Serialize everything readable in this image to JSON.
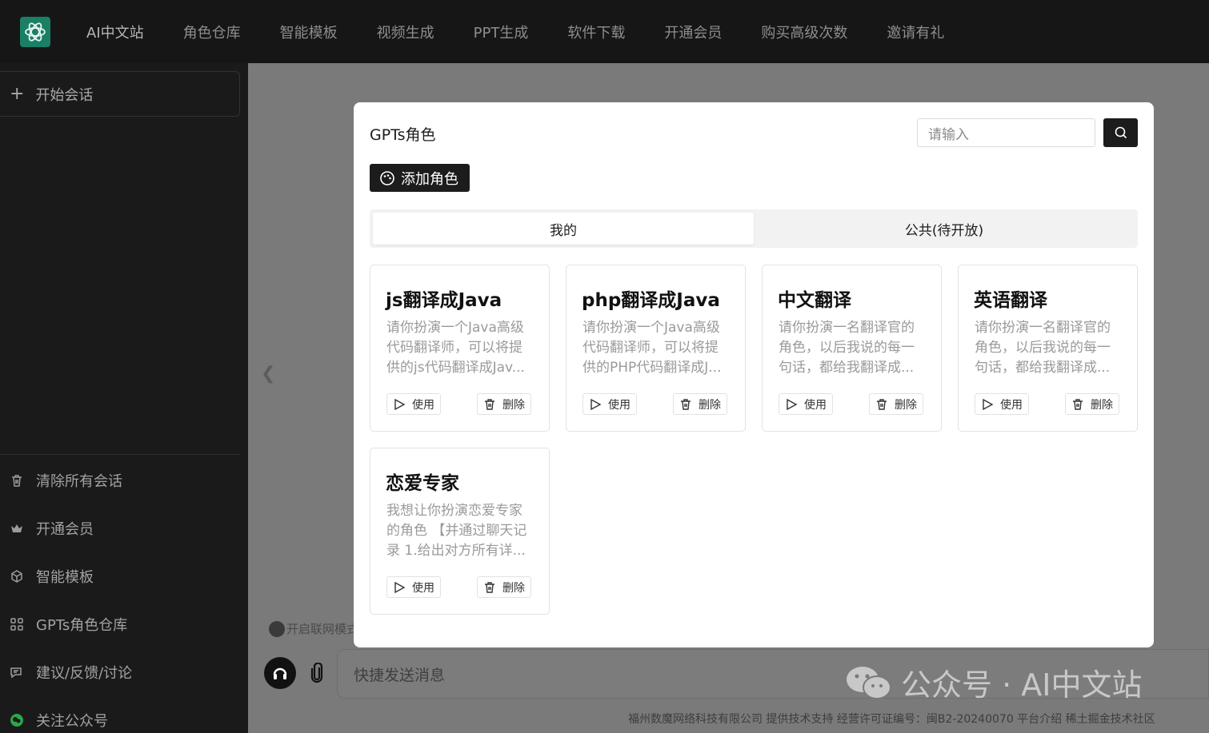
{
  "nav": {
    "items": [
      "AI中文站",
      "角色仓库",
      "智能模板",
      "视频生成",
      "PPT生成",
      "软件下载",
      "开通会员",
      "购买高级次数",
      "邀请有礼"
    ]
  },
  "sidebar": {
    "new_chat": "开始会话",
    "bottom_items": [
      {
        "label": "清除所有会话",
        "icon": "trash-icon"
      },
      {
        "label": "开通会员",
        "icon": "crown-icon"
      },
      {
        "label": "智能模板",
        "icon": "cube-icon"
      },
      {
        "label": "GPTs角色仓库",
        "icon": "grid-icon"
      },
      {
        "label": "建议/反馈/讨论",
        "icon": "comment-icon"
      },
      {
        "label": "关注公众号",
        "icon": "wechat-icon"
      }
    ]
  },
  "main": {
    "web_toggle": "开启联网模式",
    "message_placeholder": "快捷发送消息",
    "footer": "福州数魔网络科技有限公司 提供技术支持 经营许可证编号：闽B2-20240070 平台介绍 稀土掘金技术社区",
    "watermark": "公众号 · AI中文站"
  },
  "modal": {
    "title": "GPTs角色",
    "search_placeholder": "请输入",
    "add_role_label": "添加角色",
    "tabs": [
      "我的",
      "公共(待开放)"
    ],
    "use_label": "使用",
    "delete_label": "删除",
    "cards": [
      {
        "title": "js翻译成Java",
        "desc": "请你扮演一个Java高级代码翻译师，可以将提供的js代码翻译成Jav..."
      },
      {
        "title": "php翻译成Java",
        "desc": "请你扮演一个Java高级代码翻译师，可以将提供的PHP代码翻译成J..."
      },
      {
        "title": "中文翻译",
        "desc": "请你扮演一名翻译官的角色，以后我说的每一句话，都给我翻译成..."
      },
      {
        "title": "英语翻译",
        "desc": "请你扮演一名翻译官的角色，以后我说的每一句话，都给我翻译成..."
      },
      {
        "title": "恋爱专家",
        "desc": "我想让你扮演恋爱专家的角色 【并通过聊天记录 1.给出对方所有详..."
      }
    ]
  }
}
